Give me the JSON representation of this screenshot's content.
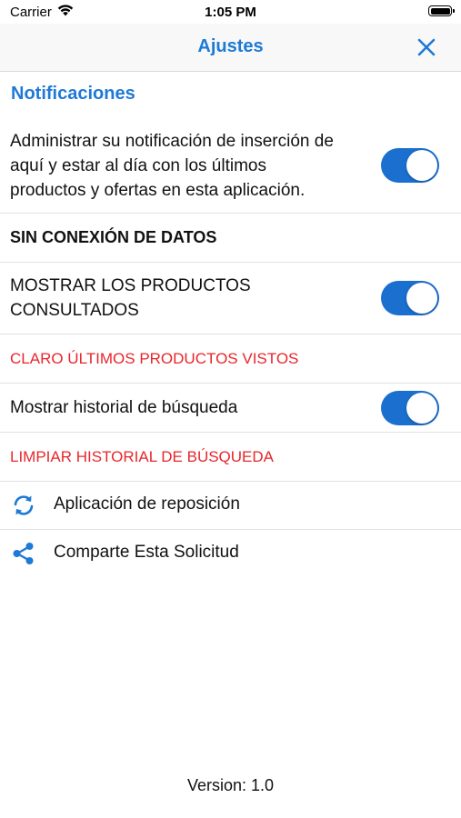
{
  "status_bar": {
    "carrier": "Carrier",
    "time": "1:05 PM",
    "icons": [
      "wifi-icon",
      "battery-icon"
    ]
  },
  "nav": {
    "title": "Ajustes",
    "close_icon": "close-icon"
  },
  "notifications": {
    "header": "Notificaciones",
    "description_lines": [
      "Administrar su notificación de inserción de",
      "aquí y estar al día con los últimos",
      "productos y ofertas en esta aplicación."
    ],
    "toggle_on": true
  },
  "offline": {
    "header": "SIN CONEXIÓN DE DATOS",
    "show_products_lines": [
      "MOSTRAR LOS PRODUCTOS",
      "CONSULTADOS"
    ],
    "show_products_on": true,
    "clear_products": "CLARO ÚLTIMOS PRODUCTOS VISTOS",
    "show_history": "Mostrar historial de búsqueda",
    "show_history_on": true,
    "clear_history": "LIMPIAR HISTORIAL DE BÚSQUEDA"
  },
  "actions": {
    "restore": "Aplicación de reposición",
    "share": "Comparte Esta Solicitud"
  },
  "footer": {
    "version": "Version: 1.0"
  },
  "colors": {
    "accent": "#1e7ad6",
    "toggle": "#1a6fcf",
    "danger": "#e8262b"
  }
}
